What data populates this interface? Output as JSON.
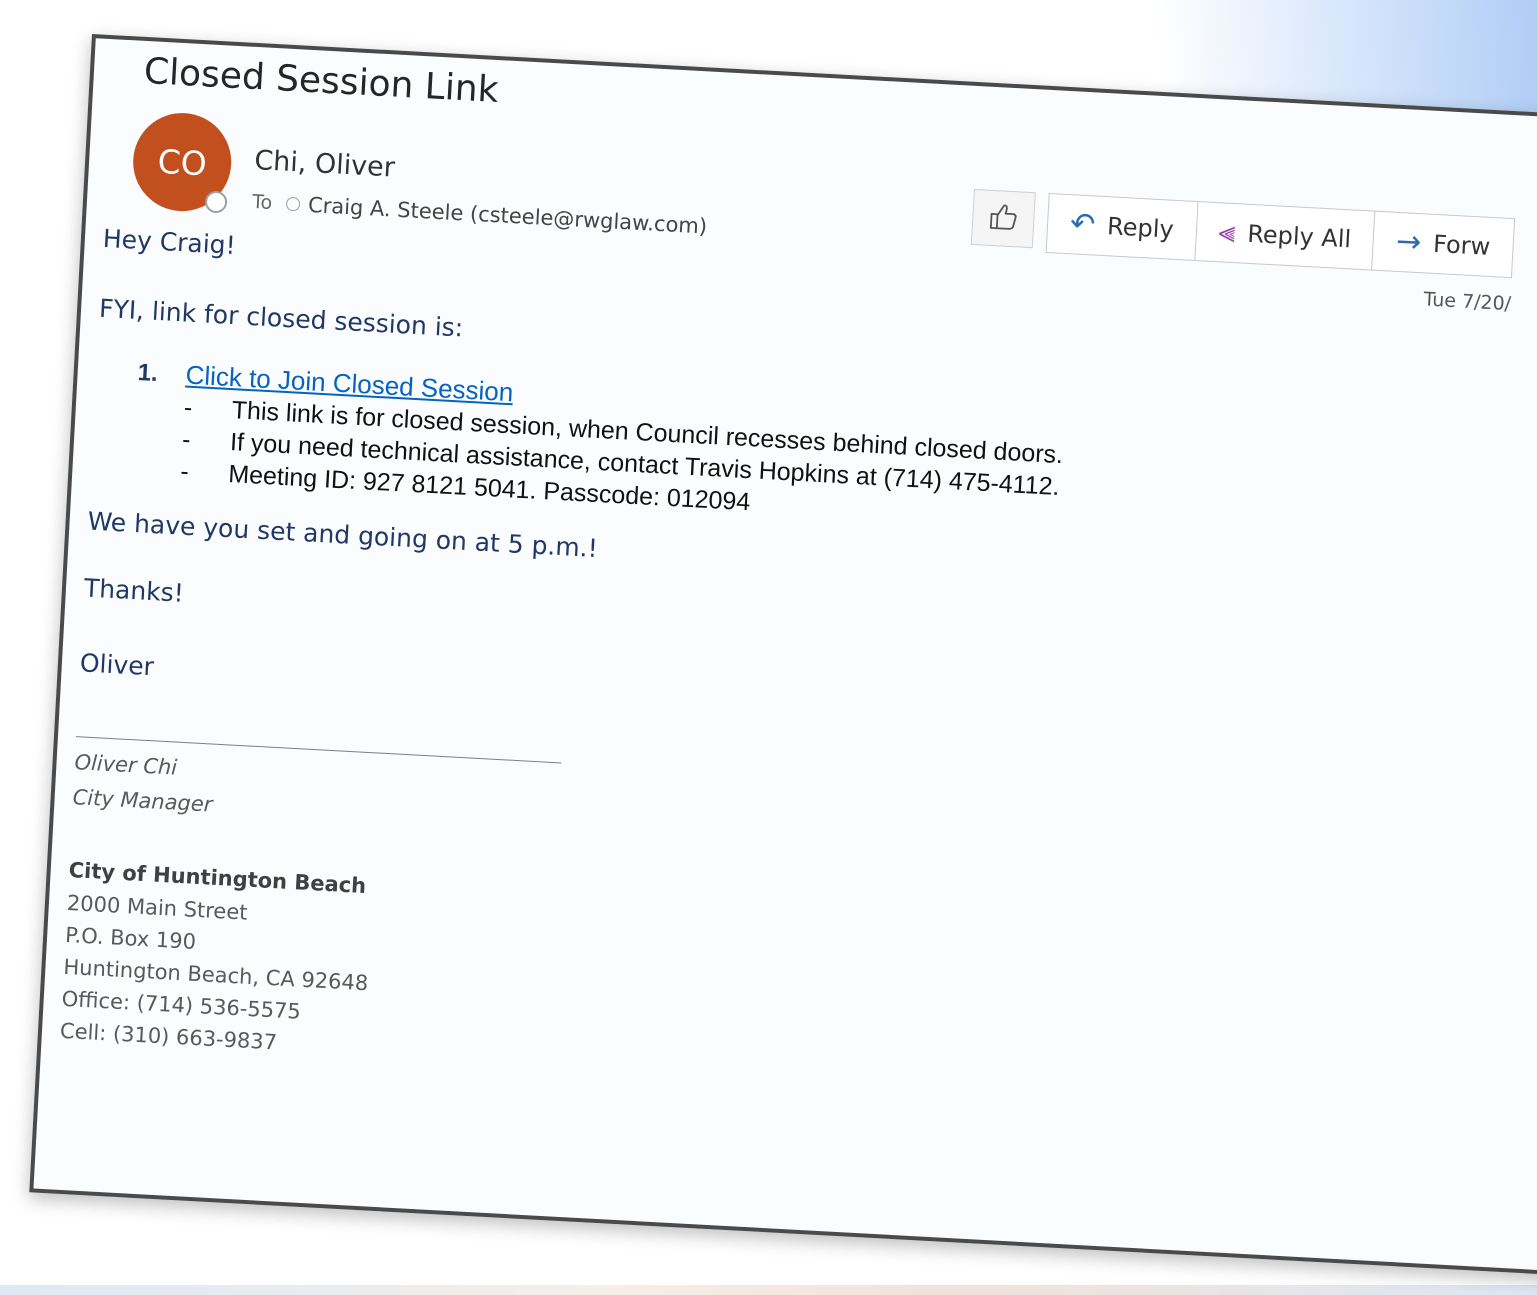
{
  "email": {
    "subject": "Closed Session Link",
    "sender": {
      "initials": "CO",
      "name": "Chi, Oliver",
      "avatar_color": "#c2501f"
    },
    "to_label": "To",
    "recipient": "Craig A. Steele (csteele@rwglaw.com)",
    "date": "Tue 7/20/",
    "actions": {
      "like_icon": "thumbs-up-icon",
      "reply": "Reply",
      "reply_all": "Reply All",
      "forward": "Forw"
    },
    "body": {
      "greeting": "Hey Craig!",
      "fyi": "FYI, link for closed session is:",
      "list_number": "1.",
      "link_text": "Click to Join Closed Session",
      "bullets": [
        "This link is for closed session, when Council recesses behind closed doors.",
        "If you need technical assistance, contact Travis Hopkins at (714) 475-4112.",
        "Meeting ID: 927 8121 5041. Passcode: 012094"
      ],
      "bullet_marker": "-",
      "set_and_going": "We have you set and going on at 5 p.m.!",
      "thanks": "Thanks!",
      "closing_name": "Oliver"
    },
    "signature": {
      "name": "Oliver Chi",
      "title": "City Manager",
      "organization": "City of Huntington Beach",
      "address_line1": "2000 Main Street",
      "address_line2": "P.O. Box 190",
      "address_line3": "Huntington Beach, CA 92648",
      "office": "Office: (714) 536-5575",
      "cell": "Cell: (310) 663-9837"
    }
  },
  "colors": {
    "body_text": "#1f3864",
    "link": "#0563c1",
    "reply_icon": "#2b6cb0",
    "reply_all_icon": "#9b3fb0"
  }
}
